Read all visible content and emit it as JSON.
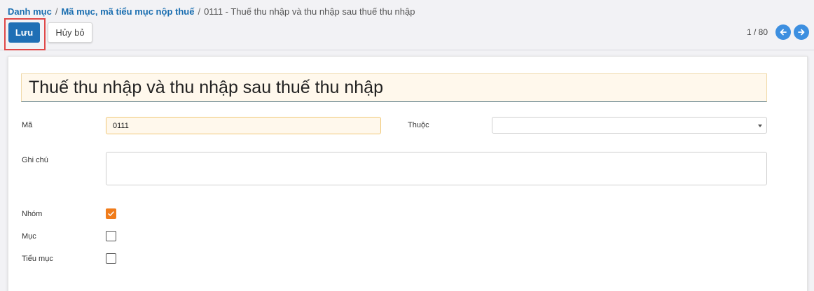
{
  "breadcrumb": {
    "items": [
      "Danh mục",
      "Mã mục, mã tiểu mục nộp thuế"
    ],
    "current": "0111 - Thuế thu nhập và thu nhập sau thuế thu nhập",
    "separator": "/"
  },
  "toolbar": {
    "save_label": "Lưu",
    "cancel_label": "Hủy bỏ"
  },
  "pager": {
    "text": "1 / 80"
  },
  "form": {
    "title_value": "Thuế thu nhập và thu nhập sau thuế thu nhập",
    "code_label": "Mã",
    "code_value": "0111",
    "parent_label": "Thuộc",
    "parent_value": "",
    "note_label": "Ghi chú",
    "note_value": "",
    "group_label": "Nhóm",
    "group_checked": true,
    "section_label": "Mục",
    "section_checked": false,
    "subsection_label": "Tiểu mục",
    "subsection_checked": false
  },
  "colors": {
    "primary": "#1f6fb5",
    "link": "#1a6eb0",
    "checkbox_checked": "#f07c1b",
    "highlight_border": "#e04848",
    "pager_button": "#3d8fe0"
  },
  "icons": {
    "prev": "arrow-left-icon",
    "next": "arrow-right-icon",
    "dropdown": "caret-down-icon",
    "check": "checkmark-icon"
  }
}
